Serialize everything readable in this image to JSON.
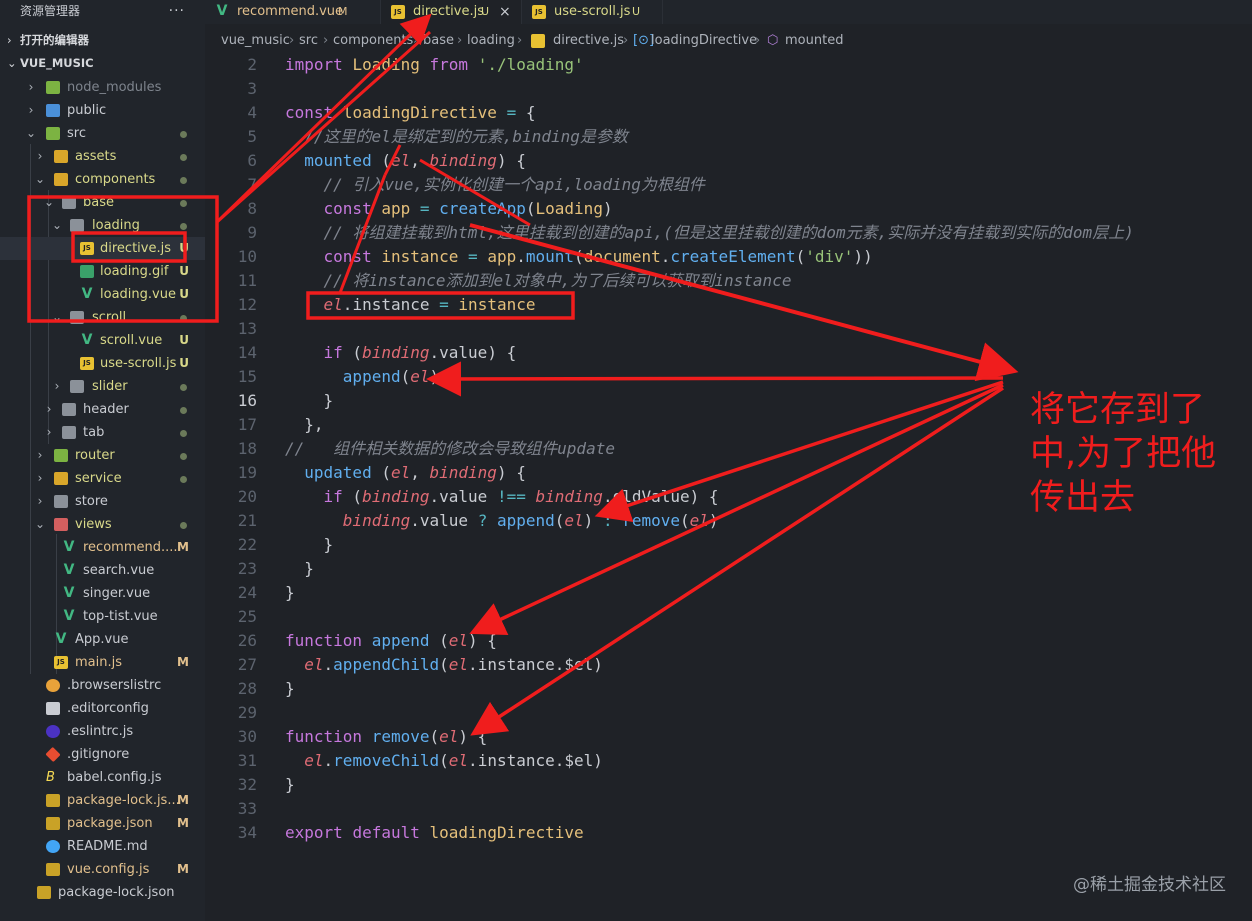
{
  "sidebar": {
    "title": "资源管理器",
    "more_label": "···",
    "open_editors": "打开的编辑器",
    "project": "VUE_MUSIC",
    "items": [
      {
        "label": "node_modules",
        "badge": ""
      },
      {
        "label": "public",
        "badge": ""
      },
      {
        "label": "src",
        "badge": ""
      },
      {
        "label": "assets",
        "badge": ""
      },
      {
        "label": "components",
        "badge": ""
      },
      {
        "label": "base",
        "badge": ""
      },
      {
        "label": "loading",
        "badge": ""
      },
      {
        "label": "directive.js",
        "badge": "U"
      },
      {
        "label": "loading.gif",
        "badge": "U"
      },
      {
        "label": "loading.vue",
        "badge": "U"
      },
      {
        "label": "scroll",
        "badge": ""
      },
      {
        "label": "scroll.vue",
        "badge": "U"
      },
      {
        "label": "use-scroll.js",
        "badge": "U"
      },
      {
        "label": "slider",
        "badge": ""
      },
      {
        "label": "header",
        "badge": ""
      },
      {
        "label": "tab",
        "badge": ""
      },
      {
        "label": "router",
        "badge": ""
      },
      {
        "label": "service",
        "badge": ""
      },
      {
        "label": "store",
        "badge": ""
      },
      {
        "label": "views",
        "badge": ""
      },
      {
        "label": "recommend....",
        "badge": "M"
      },
      {
        "label": "search.vue",
        "badge": ""
      },
      {
        "label": "singer.vue",
        "badge": ""
      },
      {
        "label": "top-tist.vue",
        "badge": ""
      },
      {
        "label": "App.vue",
        "badge": ""
      },
      {
        "label": "main.js",
        "badge": "M"
      },
      {
        "label": ".browserslistrc",
        "badge": ""
      },
      {
        "label": ".editorconfig",
        "badge": ""
      },
      {
        "label": ".eslintrc.js",
        "badge": ""
      },
      {
        "label": ".gitignore",
        "badge": ""
      },
      {
        "label": "babel.config.js",
        "badge": ""
      },
      {
        "label": "package-lock.js...",
        "badge": "M"
      },
      {
        "label": "package.json",
        "badge": "M"
      },
      {
        "label": "README.md",
        "badge": ""
      },
      {
        "label": "vue.config.js",
        "badge": "M"
      },
      {
        "label": "package-lock.json",
        "badge": ""
      }
    ]
  },
  "tabs": [
    {
      "label": "recommend.vue",
      "state": "M"
    },
    {
      "label": "directive.js",
      "state": "U",
      "close": "×"
    },
    {
      "label": "use-scroll.js",
      "state": "U"
    }
  ],
  "breadcrumb": [
    "vue_music",
    "src",
    "components",
    "base",
    "loading",
    "directive.js",
    "loadingDirective",
    "mounted"
  ],
  "annotation": "将它存到了中,为了把他传出去",
  "watermark": "@稀土掘金技术社区",
  "colors": {
    "accent_red": "#f01d1d",
    "untracked": "#73c991",
    "modified": "#e2c08d"
  }
}
